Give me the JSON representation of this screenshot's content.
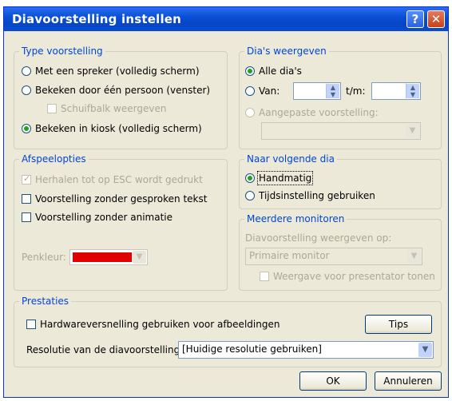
{
  "window": {
    "title": "Diavoorstelling instellen",
    "help_glyph": "?",
    "close_glyph": "✕"
  },
  "type_group": {
    "legend": "Type voorstelling",
    "opt_speaker": "Met een spreker (volledig scherm)",
    "opt_person": "Bekeken door één persoon (venster)",
    "opt_scrollbar": "Schuifbalk weergeven",
    "opt_kiosk": "Bekeken in kiosk (volledig scherm)",
    "selected": "kiosk"
  },
  "slides_group": {
    "legend": "Dia's weergeven",
    "opt_all": "Alle dia's",
    "opt_from": "Van:",
    "to_label": "t/m:",
    "from_value": "",
    "to_value": "",
    "opt_custom": "Aangepaste voorstelling:",
    "custom_value": ""
  },
  "playback_group": {
    "legend": "Afspeelopties",
    "loop": "Herhalen tot op ESC wordt gedrukt",
    "no_narration": "Voorstelling zonder gesproken tekst",
    "no_animation": "Voorstelling zonder animatie",
    "pen_label": "Penkleur:",
    "pen_color": "#e00000"
  },
  "advance_group": {
    "legend": "Naar volgende dia",
    "manual": "Handmatig",
    "timings": "Tijdsinstelling gebruiken"
  },
  "monitors_group": {
    "legend": "Meerdere monitoren",
    "show_on": "Diavoorstelling weergeven op:",
    "monitor_value": "Primaire monitor",
    "presenter_view": "Weergave voor presentator tonen"
  },
  "performance_group": {
    "legend": "Prestaties",
    "hw_accel": "Hardwareversnelling gebruiken voor afbeeldingen",
    "tips": "Tips",
    "resolution_label": "Resolutie van de diavoorstelling:",
    "resolution_value": "[Huidige resolutie gebruiken]"
  },
  "buttons": {
    "ok": "OK",
    "cancel": "Annuleren"
  }
}
